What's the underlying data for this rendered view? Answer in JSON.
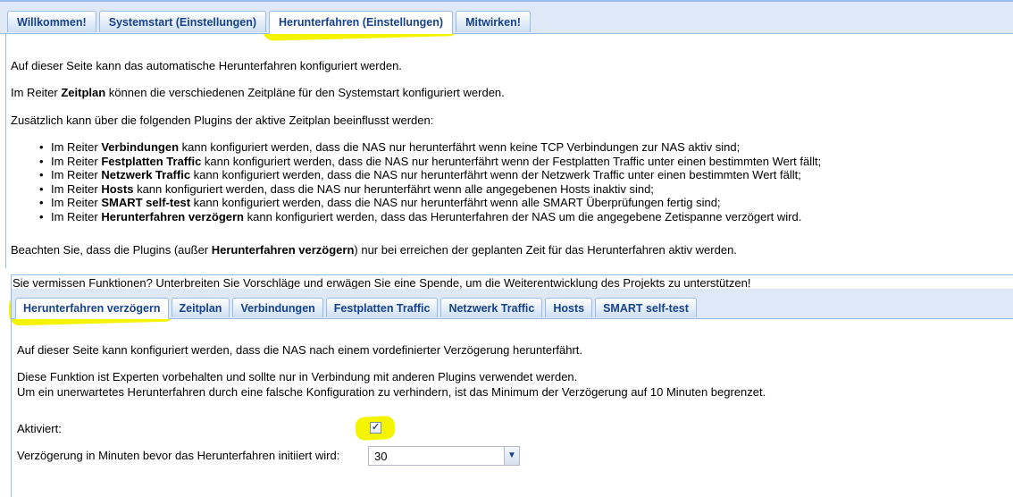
{
  "top_tabs": [
    {
      "label": "Willkommen!"
    },
    {
      "label": "Systemstart (Einstellungen)"
    },
    {
      "label": "Herunterfahren (Einstellungen)"
    },
    {
      "label": "Mitwirken!"
    }
  ],
  "intro": {
    "line1": "Auf dieser Seite kann das automatische Herunterfahren konfiguriert werden.",
    "line2_pre": "Im Reiter ",
    "line2_bold": "Zeitplan",
    "line2_post": " können die verschiedenen Zeitpläne für den Systemstart konfiguriert werden.",
    "line3": "Zusätzlich kann über die folgenden Plugins der aktive Zeitplan beeinflusst werden:"
  },
  "bullets": [
    {
      "pre": "Im Reiter ",
      "bold": "Verbindungen",
      "post": " kann konfiguriert werden, dass die NAS nur herunterfährt wenn keine TCP Verbindungen zur NAS aktiv sind;"
    },
    {
      "pre": "Im Reiter ",
      "bold": "Festplatten Traffic",
      "post": " kann konfiguriert werden, dass die NAS nur herunterfährt wenn der Festplatten Traffic unter einen bestimmten Wert fällt;"
    },
    {
      "pre": "Im Reiter ",
      "bold": "Netzwerk Traffic",
      "post": " kann konfiguriert werden, dass die NAS nur herunterfährt wenn der Netzwerk Traffic unter einen bestimmten Wert fällt;"
    },
    {
      "pre": "Im Reiter ",
      "bold": "Hosts",
      "post": " kann konfiguriert werden, dass die NAS nur herunterfährt wenn alle angegebenen Hosts inaktiv sind;"
    },
    {
      "pre": "Im Reiter ",
      "bold": "SMART self-test",
      "post": " kann konfiguriert werden, dass die NAS nur herunterfährt wenn alle SMART Überprüfungen fertig sind;"
    },
    {
      "pre": "Im Reiter ",
      "bold": "Herunterfahren verzögern",
      "post": " kann konfiguriert werden, dass das Herunterfahren der NAS um die angegebene Zetispanne verzögert wird."
    }
  ],
  "note": {
    "pre": "Beachten Sie, dass die Plugins (außer ",
    "bold": "Herunterfahren verzögern",
    "post": ") nur bei erreichen der geplanten Zeit für das Herunterfahren aktiv werden."
  },
  "donation_text": "Sie vermissen Funktionen? Unterbreiten Sie Vorschläge und erwägen Sie eine Spende, um die Weiterentwicklung des Projekts zu unterstützen!",
  "sub_tabs": [
    {
      "label": "Herunterfahren verzögern"
    },
    {
      "label": "Zeitplan"
    },
    {
      "label": "Verbindungen"
    },
    {
      "label": "Festplatten Traffic"
    },
    {
      "label": "Netzwerk Traffic"
    },
    {
      "label": "Hosts"
    },
    {
      "label": "SMART self-test"
    }
  ],
  "delay_panel": {
    "desc1": "Auf dieser Seite kann konfiguriert werden, dass die NAS nach einem vordefinierter Verzögerung herunterfährt.",
    "desc2": "Diese Funktion ist Experten vorbehalten und sollte nur in Verbindung mit anderen Plugins verwendet werden.",
    "desc3": "Um ein unerwartetes Herunterfahren durch eine falsche Konfiguration zu verhindern, ist das Minimum der Verzögerung auf 10 Minuten begrenzet.",
    "enabled_label": "Aktiviert:",
    "enabled_checked": true,
    "delay_label": "Verzögerung in Minuten bevor das Herunterfahren initiiert wird:",
    "delay_value": "30"
  },
  "colors": {
    "tab_text": "#15428b",
    "tab_border": "#99bbe8",
    "tabbar_bg": "#dfe8f6",
    "highlight": "#f4f400"
  }
}
